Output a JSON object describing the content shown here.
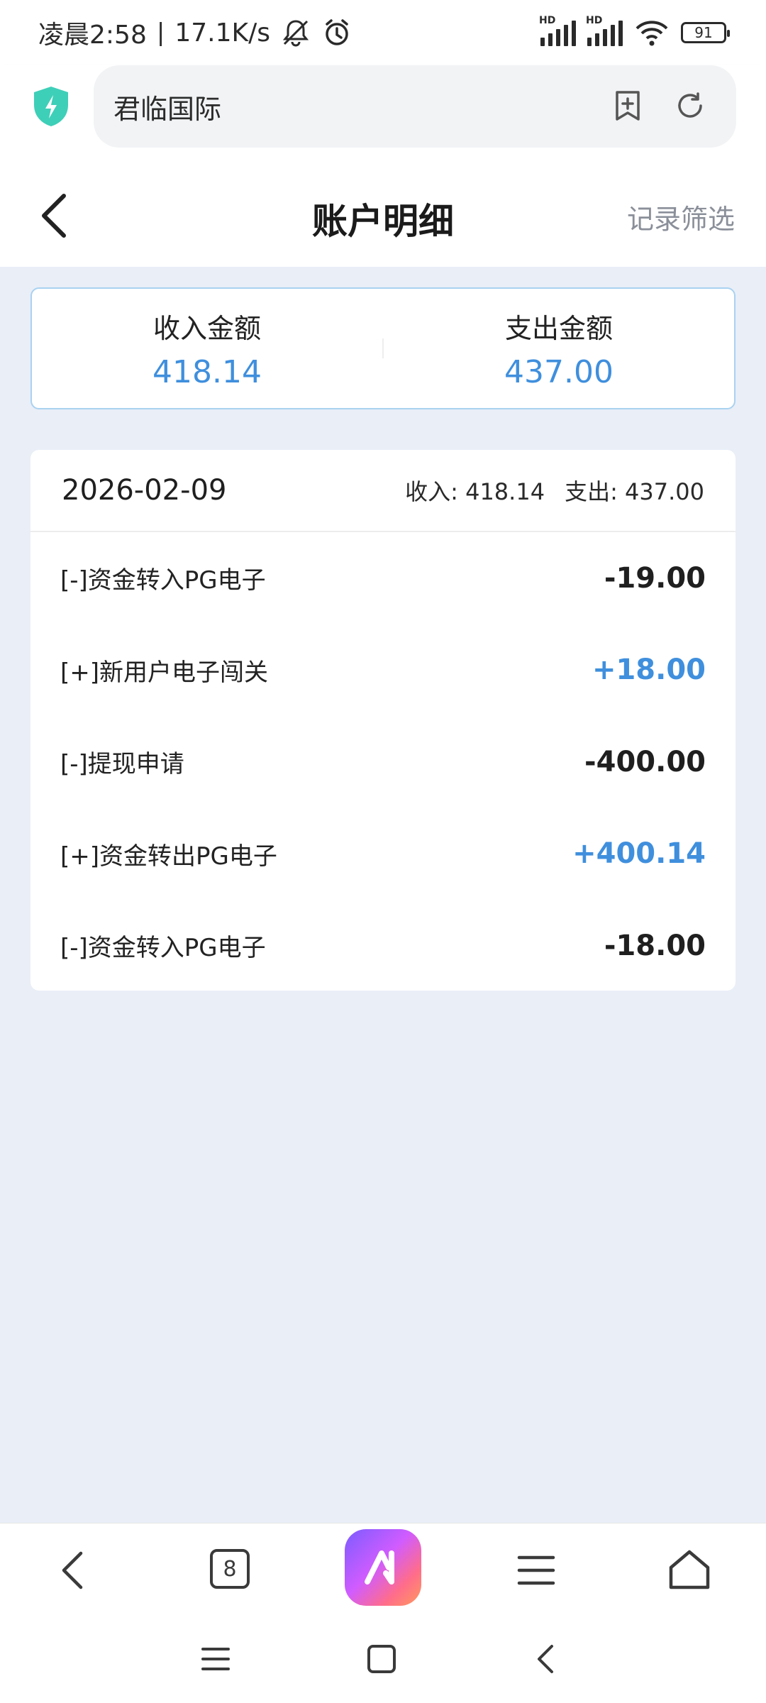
{
  "status_bar": {
    "time": "凌晨2:58",
    "speed": "17.1K/s",
    "hd_label": "HD",
    "battery": "91"
  },
  "browser": {
    "url_text": "君临国际"
  },
  "header": {
    "title": "账户明细",
    "filter_label": "记录筛选"
  },
  "summary": {
    "income_label": "收入金额",
    "income_value": "418.14",
    "expense_label": "支出金额",
    "expense_value": "437.00"
  },
  "transactions": {
    "date": "2026-02-09",
    "income_total": "收入: 418.14",
    "expense_total": "支出: 437.00",
    "rows": [
      {
        "name": "[-]资金转入PG电子",
        "amount": "-19.00",
        "positive": false
      },
      {
        "name": "[+]新用户电子闯关",
        "amount": "+18.00",
        "positive": true
      },
      {
        "name": "[-]提现申请",
        "amount": "-400.00",
        "positive": false
      },
      {
        "name": "[+]资金转出PG电子",
        "amount": "+400.14",
        "positive": true
      },
      {
        "name": "[-]资金转入PG电子",
        "amount": "-18.00",
        "positive": false
      }
    ]
  },
  "bottom_nav": {
    "tab_count": "8"
  },
  "colors": {
    "accent": "#3f8fdd",
    "background": "#e9eef7",
    "summary_border": "#a9d2f0"
  },
  "icons": [
    "shield-icon",
    "bookmark-add-icon",
    "refresh-icon",
    "back-icon",
    "ai-icon",
    "menu-icon",
    "home-icon"
  ]
}
